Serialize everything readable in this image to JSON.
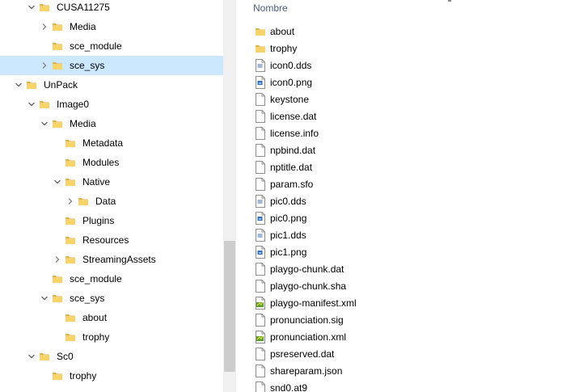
{
  "tree": {
    "items": [
      {
        "label": "CUSA11275",
        "chevron": "expanded"
      },
      {
        "label": "Media",
        "chevron": "collapsed"
      },
      {
        "label": "sce_module",
        "chevron": "none"
      },
      {
        "label": "sce_sys",
        "chevron": "collapsed",
        "selected": true
      },
      {
        "label": "UnPack",
        "chevron": "expanded"
      },
      {
        "label": "Image0",
        "chevron": "expanded"
      },
      {
        "label": "Media",
        "chevron": "expanded"
      },
      {
        "label": "Metadata",
        "chevron": "none"
      },
      {
        "label": "Modules",
        "chevron": "none"
      },
      {
        "label": "Native",
        "chevron": "expanded"
      },
      {
        "label": "Data",
        "chevron": "collapsed"
      },
      {
        "label": "Plugins",
        "chevron": "none"
      },
      {
        "label": "Resources",
        "chevron": "none"
      },
      {
        "label": "StreamingAssets",
        "chevron": "collapsed"
      },
      {
        "label": "sce_module",
        "chevron": "none"
      },
      {
        "label": "sce_sys",
        "chevron": "expanded"
      },
      {
        "label": "about",
        "chevron": "none"
      },
      {
        "label": "trophy",
        "chevron": "none"
      },
      {
        "label": "Sc0",
        "chevron": "expanded"
      },
      {
        "label": "trophy",
        "chevron": "none"
      }
    ]
  },
  "list": {
    "column_header": "Nombre",
    "items": [
      {
        "label": "about",
        "icon": "folder-icon"
      },
      {
        "label": "trophy",
        "icon": "folder-icon"
      },
      {
        "label": "icon0.dds",
        "icon": "image-file-icon"
      },
      {
        "label": "icon0.png",
        "icon": "png-file-icon"
      },
      {
        "label": "keystone",
        "icon": "file-icon"
      },
      {
        "label": "license.dat",
        "icon": "file-icon"
      },
      {
        "label": "license.info",
        "icon": "file-icon"
      },
      {
        "label": "npbind.dat",
        "icon": "file-icon"
      },
      {
        "label": "nptitle.dat",
        "icon": "file-icon"
      },
      {
        "label": "param.sfo",
        "icon": "file-icon"
      },
      {
        "label": "pic0.dds",
        "icon": "image-file-icon"
      },
      {
        "label": "pic0.png",
        "icon": "png-file-icon"
      },
      {
        "label": "pic1.dds",
        "icon": "image-file-icon"
      },
      {
        "label": "pic1.png",
        "icon": "png-file-icon"
      },
      {
        "label": "playgo-chunk.dat",
        "icon": "file-icon"
      },
      {
        "label": "playgo-chunk.sha",
        "icon": "file-icon"
      },
      {
        "label": "playgo-manifest.xml",
        "icon": "xml-file-icon"
      },
      {
        "label": "pronunciation.sig",
        "icon": "file-icon"
      },
      {
        "label": "pronunciation.xml",
        "icon": "xml-file-icon"
      },
      {
        "label": "psreserved.dat",
        "icon": "file-icon"
      },
      {
        "label": "shareparam.json",
        "icon": "file-icon"
      },
      {
        "label": "snd0.at9",
        "icon": "file-icon"
      }
    ]
  },
  "colors": {
    "selection": "#cce8ff",
    "folder": "#dcb44c",
    "folder_light": "#f6d36b",
    "header_text": "#4c607a"
  }
}
